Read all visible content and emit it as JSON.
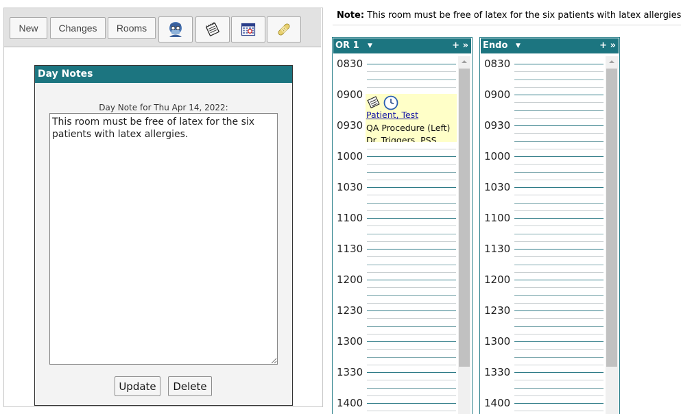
{
  "toolbar": {
    "new_label": "New",
    "changes_label": "Changes",
    "rooms_label": "Rooms",
    "icons": [
      "surgeon-icon",
      "notepad-icon",
      "calendar-icon",
      "bandage-icon"
    ]
  },
  "day_notes": {
    "title": "Day Notes",
    "caption": "Day Note for Thu Apr 14, 2022:",
    "text": "This room must be free of latex for the six patients with latex allergies.",
    "update_label": "Update",
    "delete_label": "Delete"
  },
  "note_banner": {
    "prefix": "Note:",
    "text": "This room must be free of latex for the six patients with latex allergies."
  },
  "rooms": [
    {
      "name": "OR 1",
      "caret": "▼",
      "actions": "+ »",
      "times": [
        "0830",
        "0900",
        "0930",
        "1000",
        "1030",
        "1100",
        "1130",
        "1200",
        "1230",
        "1300",
        "1330",
        "1400"
      ],
      "case": {
        "patient": "Patient, Test",
        "procedure": "QA Procedure (Left)",
        "doctor": "Dr. Triggers, PSS",
        "icons": [
          "notepad-icon",
          "clock-icon"
        ]
      }
    },
    {
      "name": "Endo",
      "caret": "▼",
      "actions": "+ »",
      "times": [
        "0830",
        "0900",
        "0930",
        "1000",
        "1030",
        "1100",
        "1130",
        "1200",
        "1230",
        "1300",
        "1330",
        "1400"
      ]
    }
  ],
  "colors": {
    "header_teal": "#1c7580",
    "case_background": "#ffffc8",
    "link_blue": "#1a1aa6"
  }
}
